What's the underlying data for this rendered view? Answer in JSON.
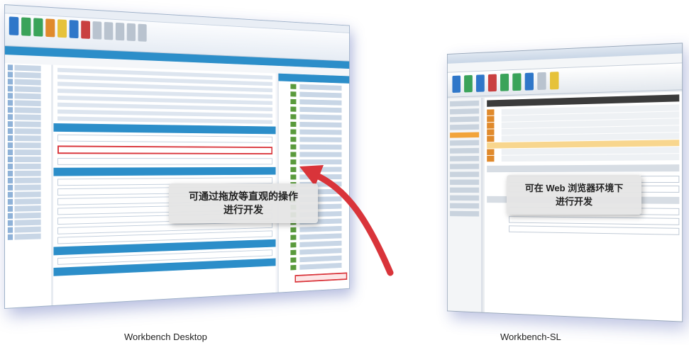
{
  "desktop": {
    "callout_line1": "可通过拖放等直观的操作",
    "callout_line2": "进行开发",
    "caption": "Workbench Desktop"
  },
  "silverlight": {
    "callout_line1": "可在 Web 浏览器环境下",
    "callout_line2": "进行开发",
    "caption": "Workbench-SL"
  },
  "colors": {
    "accent_blue": "#2c8ec9",
    "highlight_red": "#d9343a",
    "highlight_orange": "#f2a43a"
  }
}
